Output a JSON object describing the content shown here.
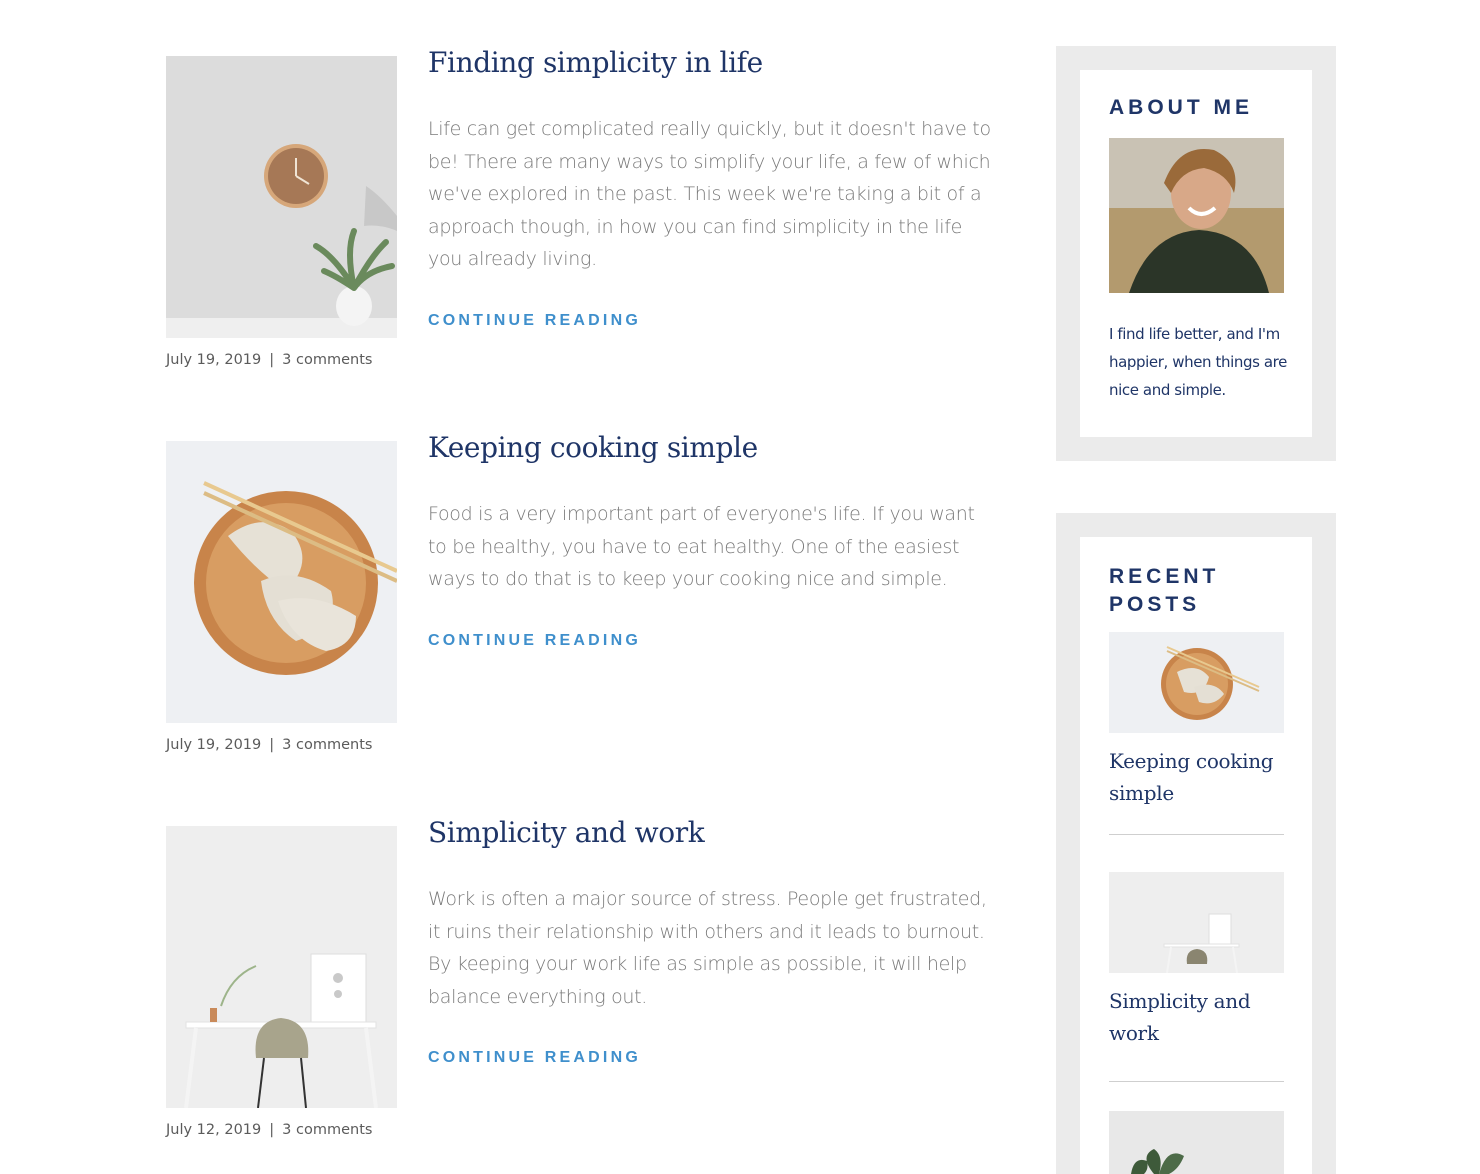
{
  "posts": [
    {
      "title": "Finding simplicity in life",
      "excerpt": "Life can get complicated really quickly, but it doesn't have to be! There are many ways to simplify your life, a few of which we've explored in the past. This week we're taking a bit of a approach though, in how you can find simplicity in the life you already living.",
      "more": "CONTINUE READING",
      "date": "July 19, 2019",
      "separator": "|",
      "comments": "3 comments",
      "image": "wall-clock-with-plant"
    },
    {
      "title": "Keeping cooking simple",
      "excerpt": "Food is a very important part of everyone's life. If you want to be healthy, you have to eat healthy. One of the easiest ways to do that is to keep your cooking nice and simple.",
      "more": "CONTINUE READING",
      "date": "July 19, 2019",
      "separator": "|",
      "comments": "3 comments",
      "image": "dumplings-on-wooden-plate"
    },
    {
      "title": "Simplicity and work",
      "excerpt": "Work is often a major source of stress. People get frustrated, it ruins their relationship with others and it leads to burnout. By keeping your work life as simple as possible, it will help balance everything out.",
      "more": "CONTINUE READING",
      "date": "July 12, 2019",
      "separator": "|",
      "comments": "3 comments",
      "image": "minimal-desk-and-chair"
    }
  ],
  "sidebar": {
    "about": {
      "title": "ABOUT ME",
      "text": "I find life better, and I'm happier, when things are nice and simple.",
      "image": "smiling-hiker-portrait"
    },
    "recent": {
      "title_line1": "RECENT",
      "title_line2": "POSTS",
      "items": [
        {
          "title": "Keeping cooking simple",
          "image": "dumplings-on-wooden-plate"
        },
        {
          "title": "Simplicity and work",
          "image": "minimal-desk-and-chair"
        },
        {
          "title": "",
          "image": "potted-plant"
        }
      ]
    }
  },
  "colors": {
    "heading": "#1f3567",
    "link": "#3f8fcc",
    "body_text": "#7a7a7a",
    "widget_bg": "#ebebeb"
  }
}
